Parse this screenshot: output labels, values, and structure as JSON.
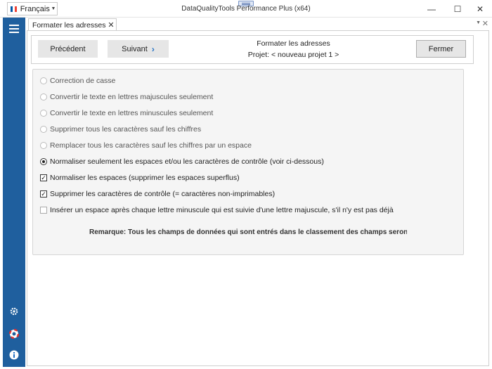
{
  "titlebar": {
    "language": "Français",
    "app_title": "DataQualityTools Performance Plus (x64)",
    "minimize": "—",
    "maximize": "☐",
    "close": "✕"
  },
  "doc_tab": {
    "label": "Formater les adresses",
    "close": "✕"
  },
  "toolbar": {
    "prev_label": "Précédent",
    "next_label": "Suivant",
    "close_label": "Fermer",
    "title": "Formater les adresses",
    "project": "Projet: < nouveau projet 1 >"
  },
  "options": [
    {
      "type": "radio",
      "checked": false,
      "enabled": false,
      "label": "Correction de casse"
    },
    {
      "type": "radio",
      "checked": false,
      "enabled": false,
      "label": "Convertir le texte en lettres majuscules seulement"
    },
    {
      "type": "radio",
      "checked": false,
      "enabled": false,
      "label": "Convertir le texte en lettres minuscules seulement"
    },
    {
      "type": "radio",
      "checked": false,
      "enabled": false,
      "label": "Supprimer tous les caractères sauf les chiffres"
    },
    {
      "type": "radio",
      "checked": false,
      "enabled": false,
      "label": "Remplacer tous les caractères sauf les chiffres par un espace"
    },
    {
      "type": "radio",
      "checked": true,
      "enabled": true,
      "label": "Normaliser seulement les espaces et/ou les caractères de contrôle (voir ci-dessous)"
    },
    {
      "type": "checkbox",
      "checked": true,
      "enabled": true,
      "label": "Normaliser les espaces (supprimer les espaces superflus)"
    },
    {
      "type": "checkbox",
      "checked": true,
      "enabled": true,
      "label": "Supprimer les caractères de contrôle (= caractères non-imprimables)"
    },
    {
      "type": "checkbox",
      "checked": false,
      "enabled": true,
      "label": "Insérer un espace après chaque lettre minuscule qui est suivie d'une lettre majuscule, s'il n'y est pas déjà"
    }
  ],
  "remark": "Remarque: Tous les champs de données qui sont entrés dans le classement des champs seront formatés",
  "rail": {
    "icons": [
      "menu-icon",
      "gear-icon",
      "lifebuoy-icon",
      "info-icon"
    ]
  },
  "colors": {
    "rail": "#1f5f9e",
    "accent": "#1f6fc4"
  }
}
